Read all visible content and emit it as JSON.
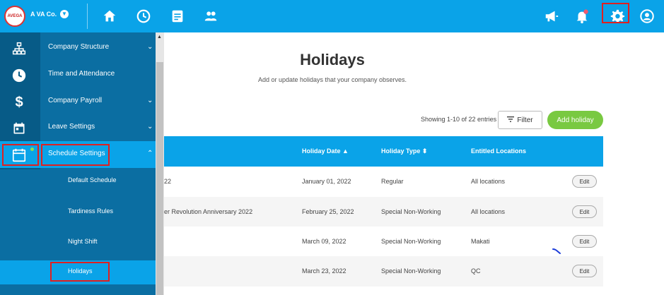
{
  "header": {
    "company_name": "A VA Co.",
    "logo_text": "AVEGA",
    "nav_icons": [
      "home-icon",
      "clock-icon",
      "document-icon",
      "people-icon"
    ],
    "right_icons": [
      "megaphone-icon",
      "bell-icon",
      "gear-icon",
      "account-icon"
    ]
  },
  "sidebar": {
    "items": [
      {
        "label": "Company Structure",
        "icon": "org-chart-icon",
        "chevron": "⌄"
      },
      {
        "label": "Time and Attendance",
        "icon": "clock-icon",
        "chevron": ""
      },
      {
        "label": "Company Payroll",
        "icon": "dollar-icon",
        "chevron": "⌄"
      },
      {
        "label": "Leave Settings",
        "icon": "calendar-icon",
        "chevron": "⌄"
      },
      {
        "label": "Schedule Settings",
        "icon": "calendar-icon",
        "chevron": "⌃"
      }
    ],
    "subitems": [
      "Default Schedule",
      "Tardiness Rules",
      "Night Shift",
      "Holidays"
    ]
  },
  "main": {
    "title": "Holidays",
    "subtitle": "Add or update holidays that your company observes.",
    "showing": "Showing 1-10 of 22 entries",
    "filter_label": "Filter",
    "add_label": "Add holiday"
  },
  "table": {
    "headers": [
      "Holiday Date ▲",
      "Holiday Type ⬍",
      "Entitled Locations"
    ],
    "rows": [
      {
        "name": "22",
        "date": "January 01, 2022",
        "type": "Regular",
        "location": "All locations",
        "action": "Edit"
      },
      {
        "name": "er Revolution Anniversary 2022",
        "date": "February 25, 2022",
        "type": "Special Non-Working",
        "location": "All locations",
        "action": "Edit"
      },
      {
        "name": "",
        "date": "March 09, 2022",
        "type": "Special Non-Working",
        "location": "Makati",
        "action": "Edit"
      },
      {
        "name": "",
        "date": "March 23, 2022",
        "type": "Special Non-Working",
        "location": "QC",
        "action": "Edit"
      }
    ]
  },
  "colors": {
    "header_blue": "#0aa3e8",
    "sidebar_blue": "#0b6ea2",
    "highlight_red": "#e02020",
    "add_green": "#79c941"
  }
}
